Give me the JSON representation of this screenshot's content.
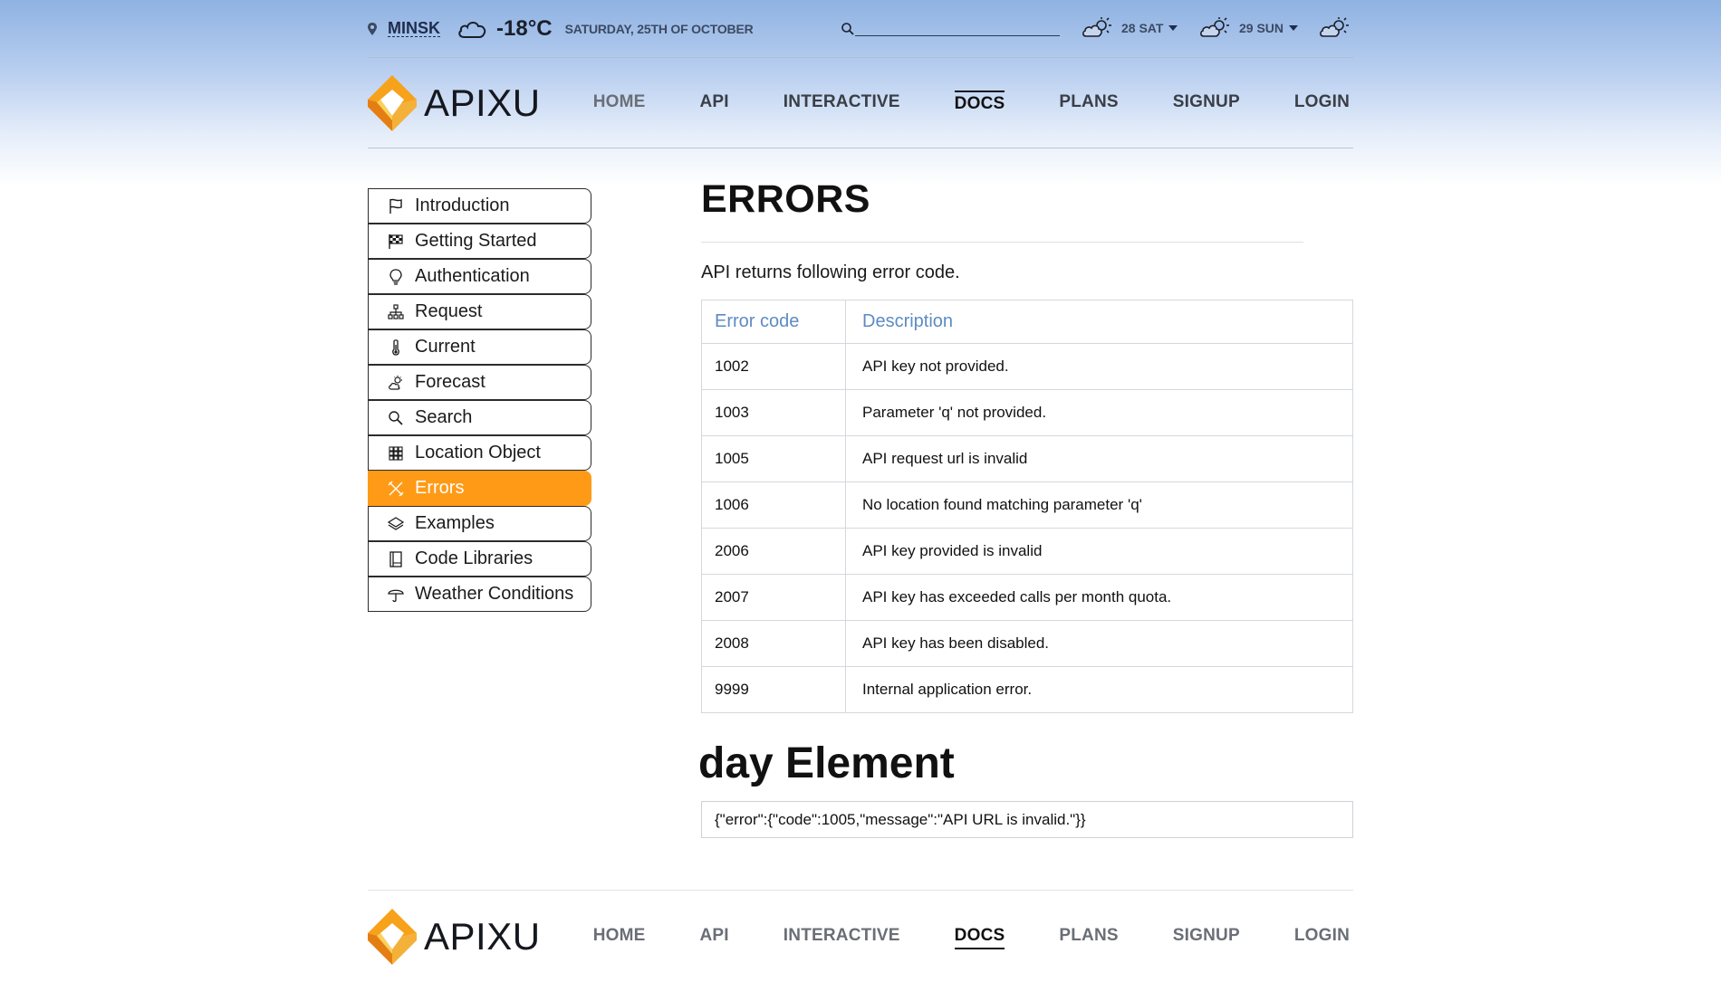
{
  "topbar": {
    "city": "MINSK",
    "temperature": "-18°C",
    "date": "SATURDAY, 25TH OF OCTOBER",
    "forecast": [
      {
        "label": "28 SAT",
        "icon": "sun-cloud-icon"
      },
      {
        "label": "29 SUN",
        "icon": "sun-cloud-icon"
      },
      {
        "label": "",
        "icon": "sun-cloud-icon"
      }
    ]
  },
  "header": {
    "logo_text": "APIXU",
    "menu": [
      "HOME",
      "API",
      "INTERACTIVE",
      "DOCS",
      "PLANS",
      "SIGNUP",
      "LOGIN"
    ],
    "active": "DOCS"
  },
  "sidebar": {
    "items": [
      {
        "label": "Introduction",
        "icon": "flag-icon"
      },
      {
        "label": "Getting Started",
        "icon": "checkered-flag-icon"
      },
      {
        "label": "Authentication",
        "icon": "lightbulb-icon"
      },
      {
        "label": "Request",
        "icon": "sitemap-icon"
      },
      {
        "label": "Current",
        "icon": "thermometer-icon"
      },
      {
        "label": "Forecast",
        "icon": "sun-cloud-icon"
      },
      {
        "label": "Search",
        "icon": "search-icon"
      },
      {
        "label": "Location Object",
        "icon": "grid-icon"
      },
      {
        "label": "Errors",
        "icon": "cross-icon",
        "active": true
      },
      {
        "label": "Examples",
        "icon": "layers-icon"
      },
      {
        "label": "Code Libraries",
        "icon": "book-icon"
      },
      {
        "label": "Weather Conditions",
        "icon": "umbrella-icon"
      }
    ]
  },
  "main": {
    "title": "ERRORS",
    "intro": "API returns following error code.",
    "table": {
      "headers": [
        "Error code",
        "Description"
      ],
      "rows": [
        [
          "1002",
          "API key not provided."
        ],
        [
          "1003",
          "Parameter 'q' not provided."
        ],
        [
          "1005",
          "API request url is invalid"
        ],
        [
          "1006",
          "No location found matching parameter 'q'"
        ],
        [
          "2006",
          "API key provided is invalid"
        ],
        [
          "2007",
          "API key has exceeded calls per month quota."
        ],
        [
          "2008",
          "API key has been disabled."
        ],
        [
          "9999",
          "Internal application error."
        ]
      ]
    },
    "section_title": "day Element",
    "code": "{\"error\":{\"code\":1005,\"message\":\"API URL is invalid.\"}}"
  },
  "footer": {
    "logo_text": "APIXU",
    "menu": [
      "HOME",
      "API",
      "INTERACTIVE",
      "DOCS",
      "PLANS",
      "SIGNUP",
      "LOGIN"
    ]
  },
  "colors": {
    "accent": "#ff9a16",
    "table_header": "#5d8bc3",
    "logo_orange": "#f7a21b",
    "logo_dark_orange": "#e57e12"
  }
}
